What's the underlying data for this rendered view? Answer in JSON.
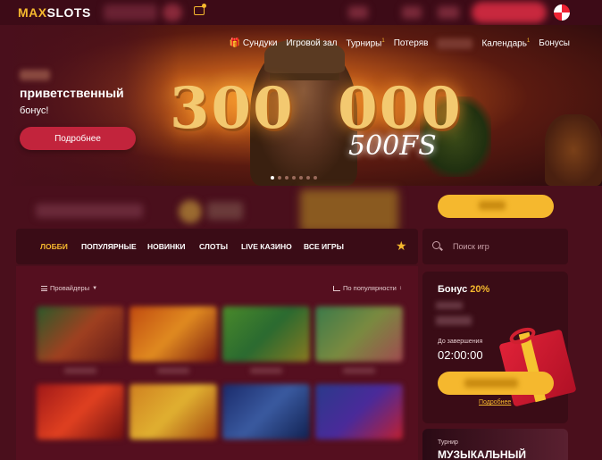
{
  "brand": {
    "logo_max": "MAX",
    "logo_slots": "SLOTS"
  },
  "colors": {
    "accent": "#f5b82e",
    "primary": "#c2243c",
    "background": "#4a0f1c",
    "panel": "#3a0c16"
  },
  "hero": {
    "nav": [
      {
        "label": "Сундуки",
        "icon": "chest-icon"
      },
      {
        "label": "Игровой зал"
      },
      {
        "label": "Турниры",
        "badge": "1"
      },
      {
        "label": "Потеряв"
      },
      {
        "label": "Календарь",
        "badge": "1"
      },
      {
        "label": "Бонусы"
      }
    ],
    "title": "приветственный",
    "subtitle": "бонус!",
    "button": "Подробнее",
    "big_left": "300",
    "big_right": "000",
    "freespins": "500FS",
    "slide_count": 7,
    "active_slide": 1
  },
  "lobby": {
    "tabs": [
      "ЛОББИ",
      "ПОПУЛЯРНЫЕ",
      "НОВИНКИ",
      "СЛОТЫ",
      "LIVE КАЗИНО",
      "ВСЕ ИГРЫ"
    ],
    "active_tab": 0,
    "favorites_icon": "star-icon",
    "providers_label": "Провайдеры",
    "sort_label": "По популярности"
  },
  "search": {
    "placeholder": "Поиск игр",
    "icon": "search-icon"
  },
  "bonus_card": {
    "title": "Бонус ",
    "percent": "20%",
    "until_label": "До завершения",
    "timer": "02:00:00",
    "more_link": "Подробнее"
  },
  "tournament": {
    "label": "Турнир",
    "title": "МУЗЫКАЛЬНЫЙ"
  }
}
